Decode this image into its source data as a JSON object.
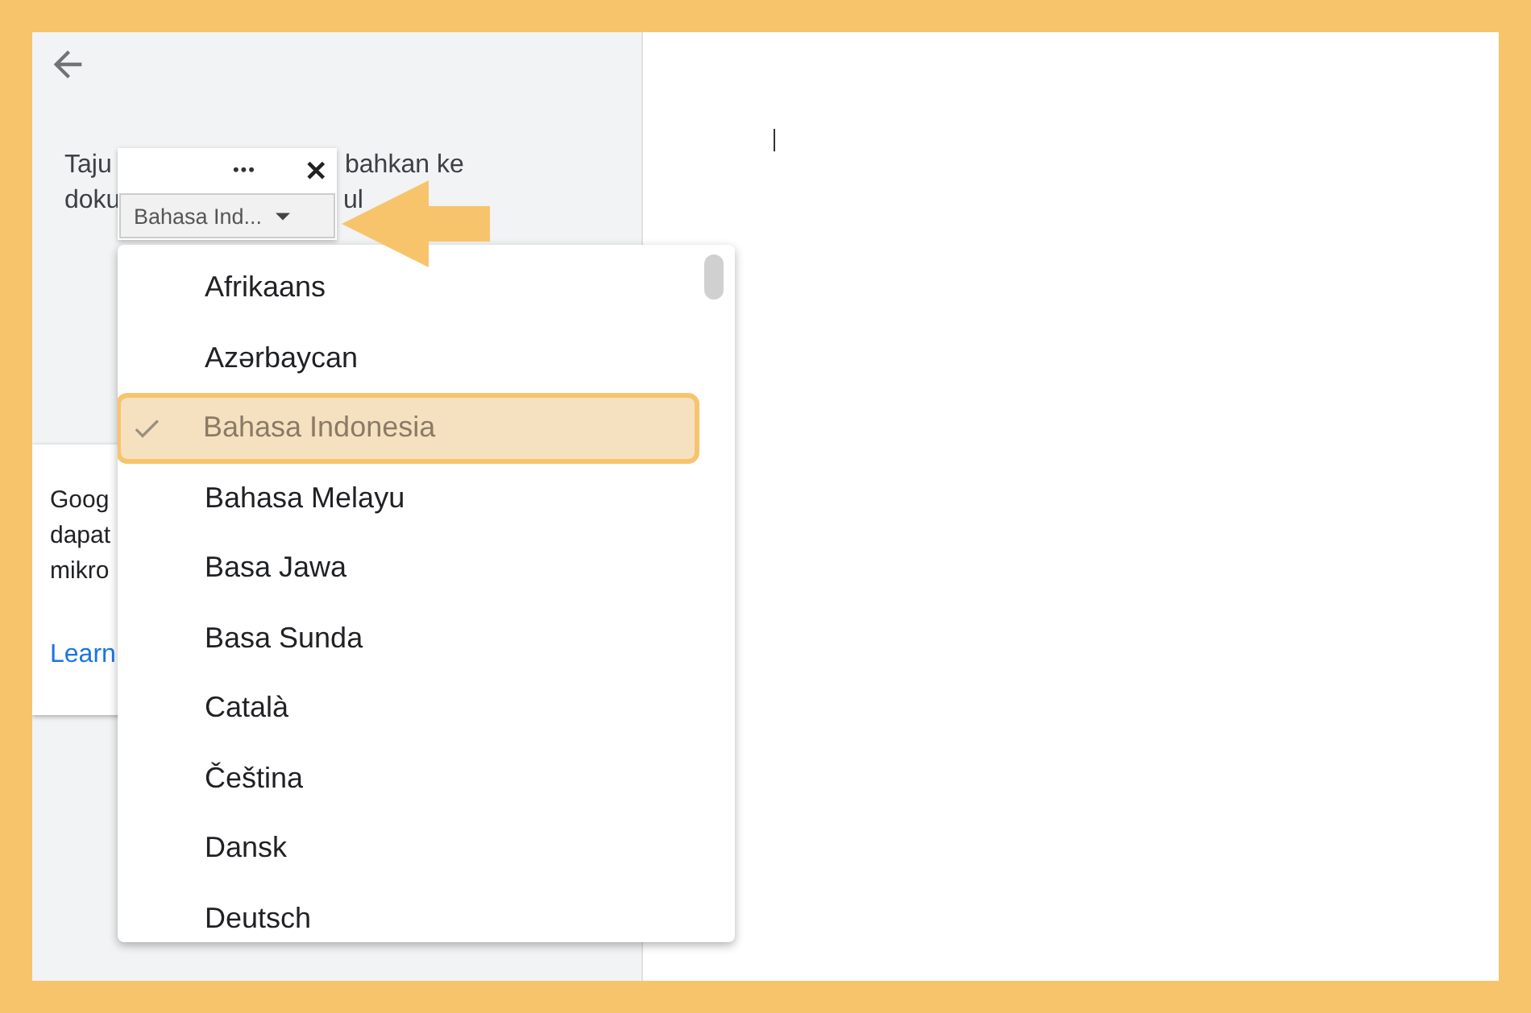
{
  "side_panel": {
    "text_fragments": [
      "Taju",
      "bahkan ke",
      "doku",
      "ul"
    ]
  },
  "info_card": {
    "lines": [
      "Goog",
      "dapat",
      "mikro"
    ],
    "link": "Learn"
  },
  "toolbar": {
    "more": "•••",
    "close": "✕",
    "language_button": "Bahasa Ind..."
  },
  "language_menu": {
    "items": [
      {
        "label": "Afrikaans",
        "selected": false
      },
      {
        "label": "Azərbaycan",
        "selected": false
      },
      {
        "label": "Bahasa Indonesia",
        "selected": true
      },
      {
        "label": "Bahasa Melayu",
        "selected": false
      },
      {
        "label": "Basa Jawa",
        "selected": false
      },
      {
        "label": "Basa Sunda",
        "selected": false
      },
      {
        "label": "Català",
        "selected": false
      },
      {
        "label": "Čeština",
        "selected": false
      },
      {
        "label": "Dansk",
        "selected": false
      },
      {
        "label": "Deutsch",
        "selected": false
      }
    ]
  }
}
